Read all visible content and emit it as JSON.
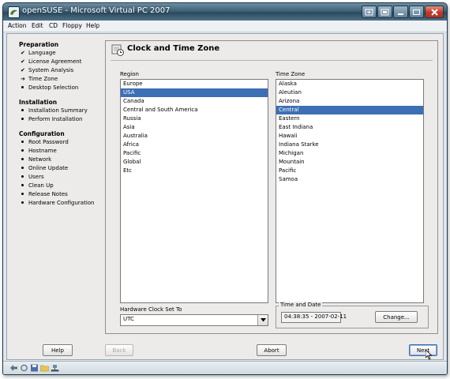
{
  "window": {
    "title": "openSUSE - Microsoft Virtual PC 2007"
  },
  "menu": [
    "Action",
    "Edit",
    "CD",
    "Floppy",
    "Help"
  ],
  "sidebar": {
    "sections": [
      {
        "title": "Preparation",
        "items": [
          {
            "label": "Language",
            "state": "done"
          },
          {
            "label": "License Agreement",
            "state": "done"
          },
          {
            "label": "System Analysis",
            "state": "done"
          },
          {
            "label": "Time Zone",
            "state": "current"
          },
          {
            "label": "Desktop Selection",
            "state": "todo"
          }
        ]
      },
      {
        "title": "Installation",
        "items": [
          {
            "label": "Installation Summary",
            "state": "todo"
          },
          {
            "label": "Perform Installation",
            "state": "todo"
          }
        ]
      },
      {
        "title": "Configuration",
        "items": [
          {
            "label": "Root Password",
            "state": "todo"
          },
          {
            "label": "Hostname",
            "state": "todo"
          },
          {
            "label": "Network",
            "state": "todo"
          },
          {
            "label": "Online Update",
            "state": "todo"
          },
          {
            "label": "Users",
            "state": "todo"
          },
          {
            "label": "Clean Up",
            "state": "todo"
          },
          {
            "label": "Release Notes",
            "state": "todo"
          },
          {
            "label": "Hardware Configuration",
            "state": "todo"
          }
        ]
      }
    ]
  },
  "panel": {
    "title": "Clock and Time Zone",
    "region_label": "Region",
    "regions": [
      "Europe",
      "USA",
      "Canada",
      "Central and South America",
      "Russia",
      "Asia",
      "Australia",
      "Africa",
      "Pacific",
      "Global",
      "Etc"
    ],
    "region_selected": "USA",
    "timezone_label": "Time Zone",
    "timezones": [
      "Alaska",
      "Aleutian",
      "Arizona",
      "Central",
      "Eastern",
      "East Indiana",
      "Hawaii",
      "Indiana Starke",
      "Michigan",
      "Mountain",
      "Pacific",
      "Samoa"
    ],
    "timezone_selected": "Central",
    "hwclock_label": "Hardware Clock Set To",
    "hwclock_value": "UTC",
    "datetime_legend": "Time and Date",
    "datetime_value": "04:38:35 - 2007-02-11",
    "change_label": "Change..."
  },
  "buttons": {
    "help": "Help",
    "back": "Back",
    "abort": "Abort",
    "next": "Next"
  },
  "colors": {
    "selection": "#3d6fb4",
    "titlebar": "#3f6277",
    "close": "#c0392b"
  },
  "statusbar_icons": [
    "back-arrow-icon",
    "refresh-icon",
    "floppy-icon",
    "folder-icon",
    "network-icon"
  ]
}
